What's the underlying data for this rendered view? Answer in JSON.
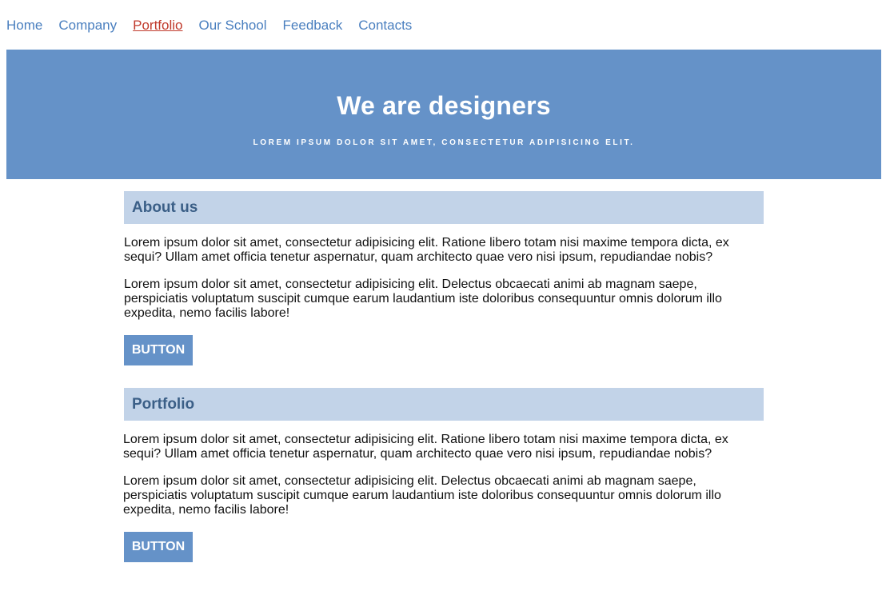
{
  "nav": {
    "items": [
      {
        "label": "Home"
      },
      {
        "label": "Company"
      },
      {
        "label": "Portfolio",
        "active": true
      },
      {
        "label": "Our School"
      },
      {
        "label": "Feedback"
      },
      {
        "label": "Contacts"
      }
    ]
  },
  "hero": {
    "title": "We are designers",
    "tagline": "LOREM IPSUM DOLOR SIT AMET, CONSECTETUR ADIPISICING ELIT."
  },
  "sections": [
    {
      "title": "About us",
      "paragraphs": [
        "Lorem ipsum dolor sit amet, consectetur adipisicing elit. Ratione libero totam nisi maxime tempora dicta, ex sequi? Ullam amet officia tenetur aspernatur, quam architecto quae vero nisi ipsum, repudiandae nobis?",
        "Lorem ipsum dolor sit amet, consectetur adipisicing elit. Delectus obcaecati animi ab magnam saepe, perspiciatis voluptatum suscipit cumque earum laudantium iste doloribus consequuntur omnis dolorum illo expedita, nemo facilis labore!"
      ],
      "button_label": "BUTTON"
    },
    {
      "title": "Portfolio",
      "paragraphs": [
        "Lorem ipsum dolor sit amet, consectetur adipisicing elit. Ratione libero totam nisi maxime tempora dicta, ex sequi? Ullam amet officia tenetur aspernatur, quam architecto quae vero nisi ipsum, repudiandae nobis?",
        "Lorem ipsum dolor sit amet, consectetur adipisicing elit. Delectus obcaecati animi ab magnam saepe, perspiciatis voluptatum suscipit cumque earum laudantium iste doloribus consequuntur omnis dolorum illo expedita, nemo facilis labore!"
      ],
      "button_label": "BUTTON"
    }
  ],
  "colors": {
    "accent": "#6592c8",
    "nav_link": "#4a7fbf",
    "nav_active": "#c0392b",
    "section_header_bg": "#c2d3e8",
    "section_header_text": "#3b5f87"
  }
}
